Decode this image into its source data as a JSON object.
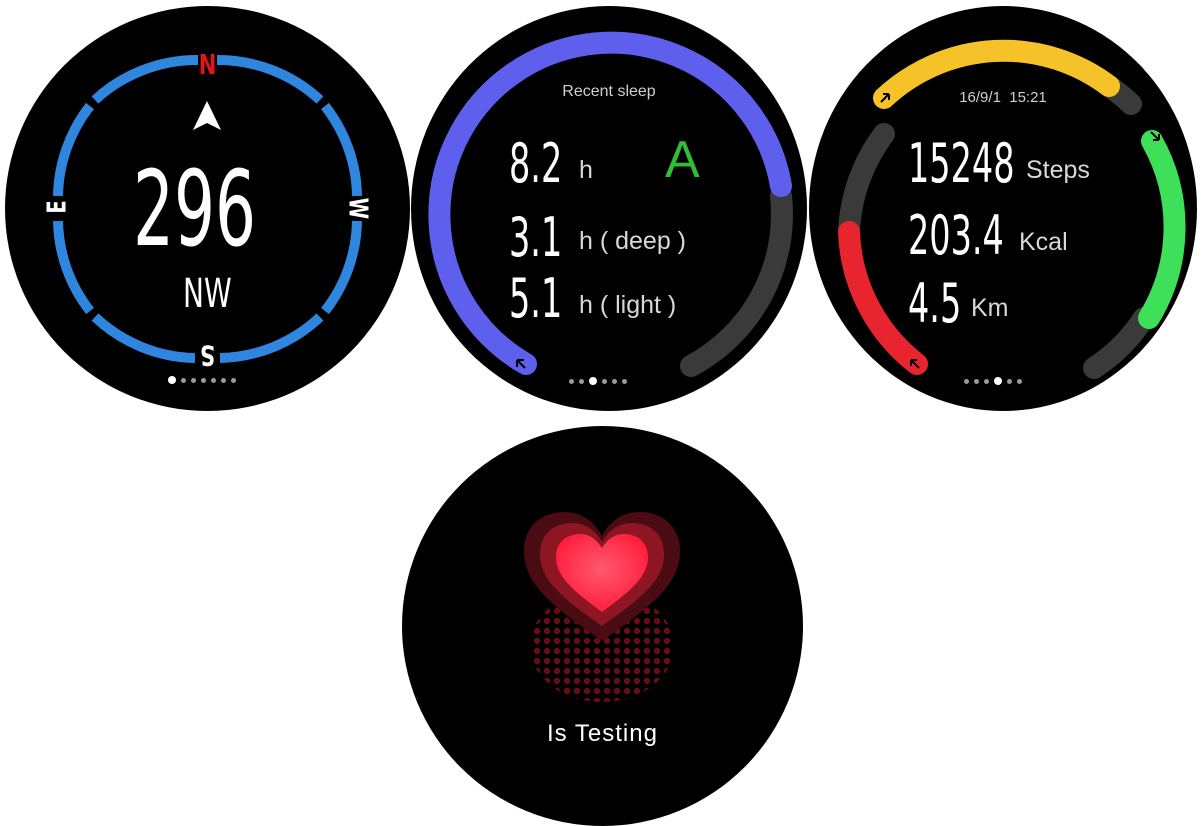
{
  "compass": {
    "heading_value": "296",
    "direction": "NW",
    "north_label": "N",
    "south_label": "S",
    "east_label": "E",
    "west_label": "W",
    "page_index": 0,
    "page_count": 7,
    "colors": {
      "ring": "#2e86de",
      "north": "#e3141b"
    }
  },
  "sleep": {
    "title": "Recent sleep",
    "grade": "A",
    "rows": [
      {
        "value": "8.2",
        "unit": "h"
      },
      {
        "value": "3.1",
        "unit": "h ( deep )"
      },
      {
        "value": "5.1",
        "unit": "h ( light )"
      }
    ],
    "page_index": 1,
    "page_count": 6,
    "colors": {
      "arc": "#5f5fee",
      "grade": "#2ec02e"
    }
  },
  "activity": {
    "datetime": "16/9/1  15:21",
    "rows": [
      {
        "value": "15248",
        "unit": "Steps"
      },
      {
        "value": "203.4",
        "unit": "Kcal"
      },
      {
        "value": "4.5",
        "unit": "Km"
      }
    ],
    "page_index": 2,
    "page_count": 6,
    "colors": {
      "steps": "#f5c22a",
      "kcal": "#e8252f",
      "km": "#3ee05a"
    }
  },
  "heart": {
    "status": "Is Testing",
    "colors": {
      "heart": "#ff2f4a"
    }
  }
}
